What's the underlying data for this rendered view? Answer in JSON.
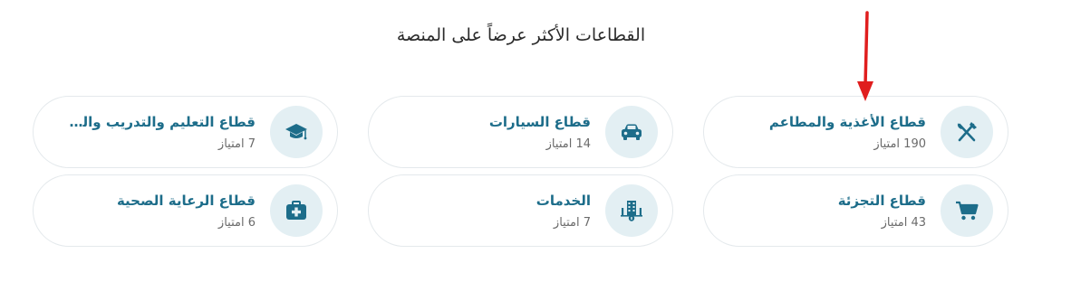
{
  "section": {
    "title": "القطاعات الأكثر عرضاً على المنصة"
  },
  "colors": {
    "accent": "#1d6d8a",
    "icon_bg": "#e3eff3",
    "arrow": "#e01e1e"
  },
  "sectors": [
    {
      "name": "قطاع الأغذية والمطاعم",
      "count": "190 امتياز",
      "icon": "fork-knife-icon"
    },
    {
      "name": "قطاع السيارات",
      "count": "14 امتياز",
      "icon": "car-icon"
    },
    {
      "name": "قطاع التعليم والتدريب والتو...",
      "count": "7 امتياز",
      "icon": "graduation-cap-icon"
    },
    {
      "name": "قطاع التجزئة",
      "count": "43 امتياز",
      "icon": "cart-icon"
    },
    {
      "name": "الخدمات",
      "count": "7 امتياز",
      "icon": "building-icon"
    },
    {
      "name": "قطاع الرعاية الصحية",
      "count": "6 امتياز",
      "icon": "medical-kit-icon"
    }
  ]
}
